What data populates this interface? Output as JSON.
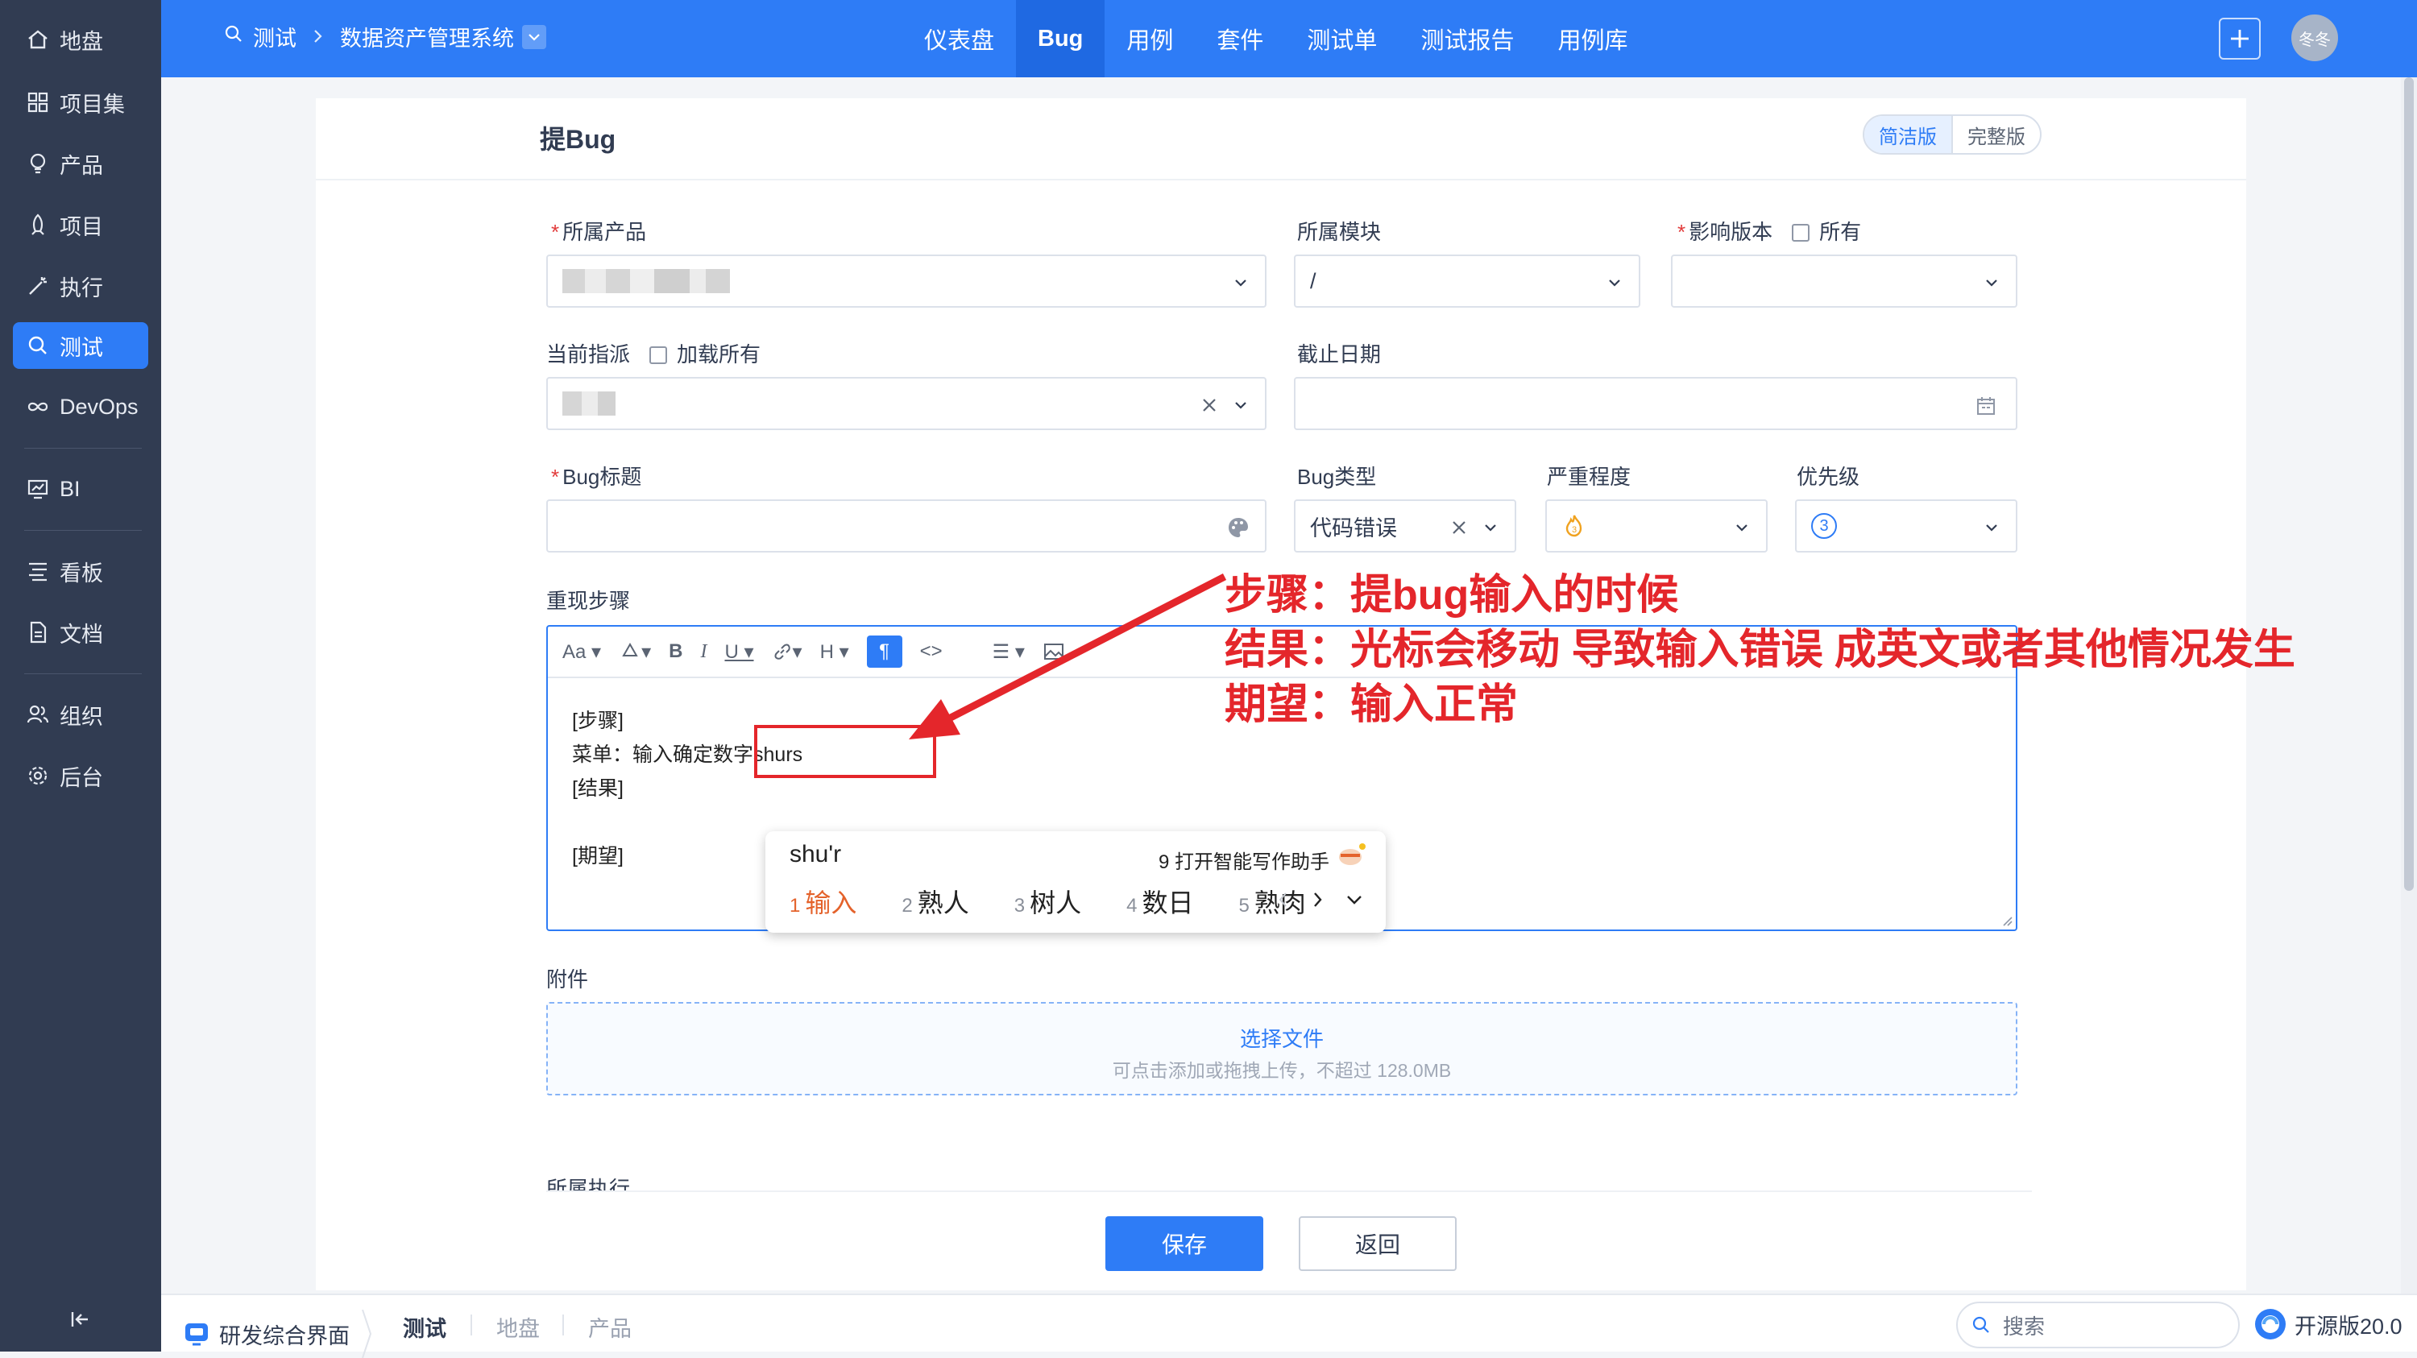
{
  "sidebar": {
    "items": [
      {
        "label": "地盘",
        "icon": "home-icon"
      },
      {
        "label": "项目集",
        "icon": "grid-icon"
      },
      {
        "label": "产品",
        "icon": "bulb-icon"
      },
      {
        "label": "项目",
        "icon": "rocket-icon"
      },
      {
        "label": "执行",
        "icon": "wand-icon"
      },
      {
        "label": "测试",
        "icon": "search-icon",
        "active": true
      },
      {
        "label": "DevOps",
        "icon": "infinity-icon"
      },
      {
        "label": "BI",
        "icon": "chart-icon"
      },
      {
        "label": "看板",
        "icon": "kanban-icon"
      },
      {
        "label": "文档",
        "icon": "doc-icon"
      },
      {
        "label": "组织",
        "icon": "people-icon"
      },
      {
        "label": "后台",
        "icon": "gear-icon"
      }
    ]
  },
  "header": {
    "breadcrumb": {
      "root": "测试",
      "current": "数据资产管理系统"
    },
    "tabs": [
      "仪表盘",
      "Bug",
      "用例",
      "套件",
      "测试单",
      "测试报告",
      "用例库"
    ],
    "active_tab": "Bug",
    "avatar_text": "冬冬"
  },
  "form": {
    "title": "提Bug",
    "mode": {
      "simple": "简洁版",
      "full": "完整版"
    },
    "product_label": "所属产品",
    "module_label": "所属模块",
    "module_value": "/",
    "version_label": "影响版本",
    "version_all": "所有",
    "assign_label": "当前指派",
    "assign_all": "加载所有",
    "deadline_label": "截止日期",
    "bug_title_label": "Bug标题",
    "bug_type_label": "Bug类型",
    "bug_type_value": "代码错误",
    "severity_label": "严重程度",
    "priority_label": "优先级",
    "priority_value": "3",
    "steps_label": "重现步骤",
    "steps_content": {
      "line1": "[步骤]",
      "line2_prefix": "菜单：输入确定数字",
      "line2_typed": "shurs",
      "line3": "[结果]",
      "line4": "[期望]"
    },
    "attach_label": "附件",
    "upload_title": "选择文件",
    "upload_hint": "可点击添加或拖拽上传，不超过 128.0MB",
    "exec_label": "所属执行",
    "save": "保存",
    "back": "返回"
  },
  "ime": {
    "composition": "shu'r",
    "assistant": "9 打开智能写作助手",
    "candidates": [
      {
        "num": "1",
        "text": "输入"
      },
      {
        "num": "2",
        "text": "熟人"
      },
      {
        "num": "3",
        "text": "树人"
      },
      {
        "num": "4",
        "text": "数日"
      },
      {
        "num": "5",
        "text": "熟肉"
      }
    ]
  },
  "annotation": {
    "step": "步骤：提bug输入的时候",
    "result": "结果：光标会移动 导致输入错误 成英文或者其他情况发生",
    "expect": "期望：输入正常"
  },
  "footer": {
    "app": "研发综合界面",
    "tabs": [
      "测试",
      "地盘",
      "产品"
    ],
    "search_placeholder": "搜索",
    "version": "开源版20.0"
  },
  "colors": {
    "primary": "#2e7cf6",
    "sidebar": "#313c52",
    "annotation": "#e4262b"
  }
}
